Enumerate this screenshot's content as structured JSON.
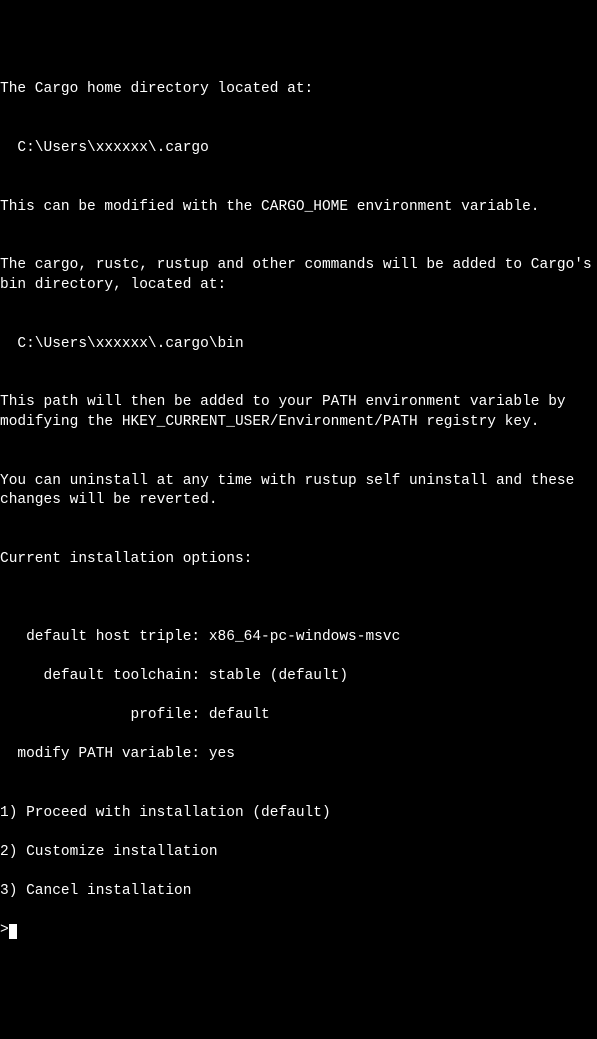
{
  "lines": {
    "l0": "The Cargo home directory located at:",
    "l1": "",
    "l2": "  C:\\Users\\xxxxxx\\.cargo",
    "l3": "",
    "l4": "This can be modified with the CARGO_HOME environment variable.",
    "l5": "",
    "l6": "The cargo, rustc, rustup and other commands will be added to Cargo's bin directory, located at:",
    "l7": "",
    "l8": "  C:\\Users\\xxxxxx\\.cargo\\bin",
    "l9": "",
    "l10": "This path will then be added to your PATH environment variable by modifying the HKEY_CURRENT_USER/Environment/PATH registry key.",
    "l11": "",
    "l12": "You can uninstall at any time with rustup self uninstall and these changes will be reverted.",
    "l13": "",
    "l14": "Current installation options:",
    "l15": "",
    "l16": "",
    "l17": "   default host triple: x86_64-pc-windows-msvc",
    "l18": "     default toolchain: stable (default)",
    "l19": "               profile: default",
    "l20": "  modify PATH variable: yes",
    "l21": "",
    "l22": "1) Proceed with installation (default)",
    "l23": "2) Customize installation",
    "l24": "3) Cancel installation"
  },
  "prompt": ">",
  "options": {
    "default_host_triple": "x86_64-pc-windows-msvc",
    "default_toolchain": "stable (default)",
    "profile": "default",
    "modify_path_variable": "yes"
  },
  "menu": {
    "1": "Proceed with installation (default)",
    "2": "Customize installation",
    "3": "Cancel installation"
  }
}
